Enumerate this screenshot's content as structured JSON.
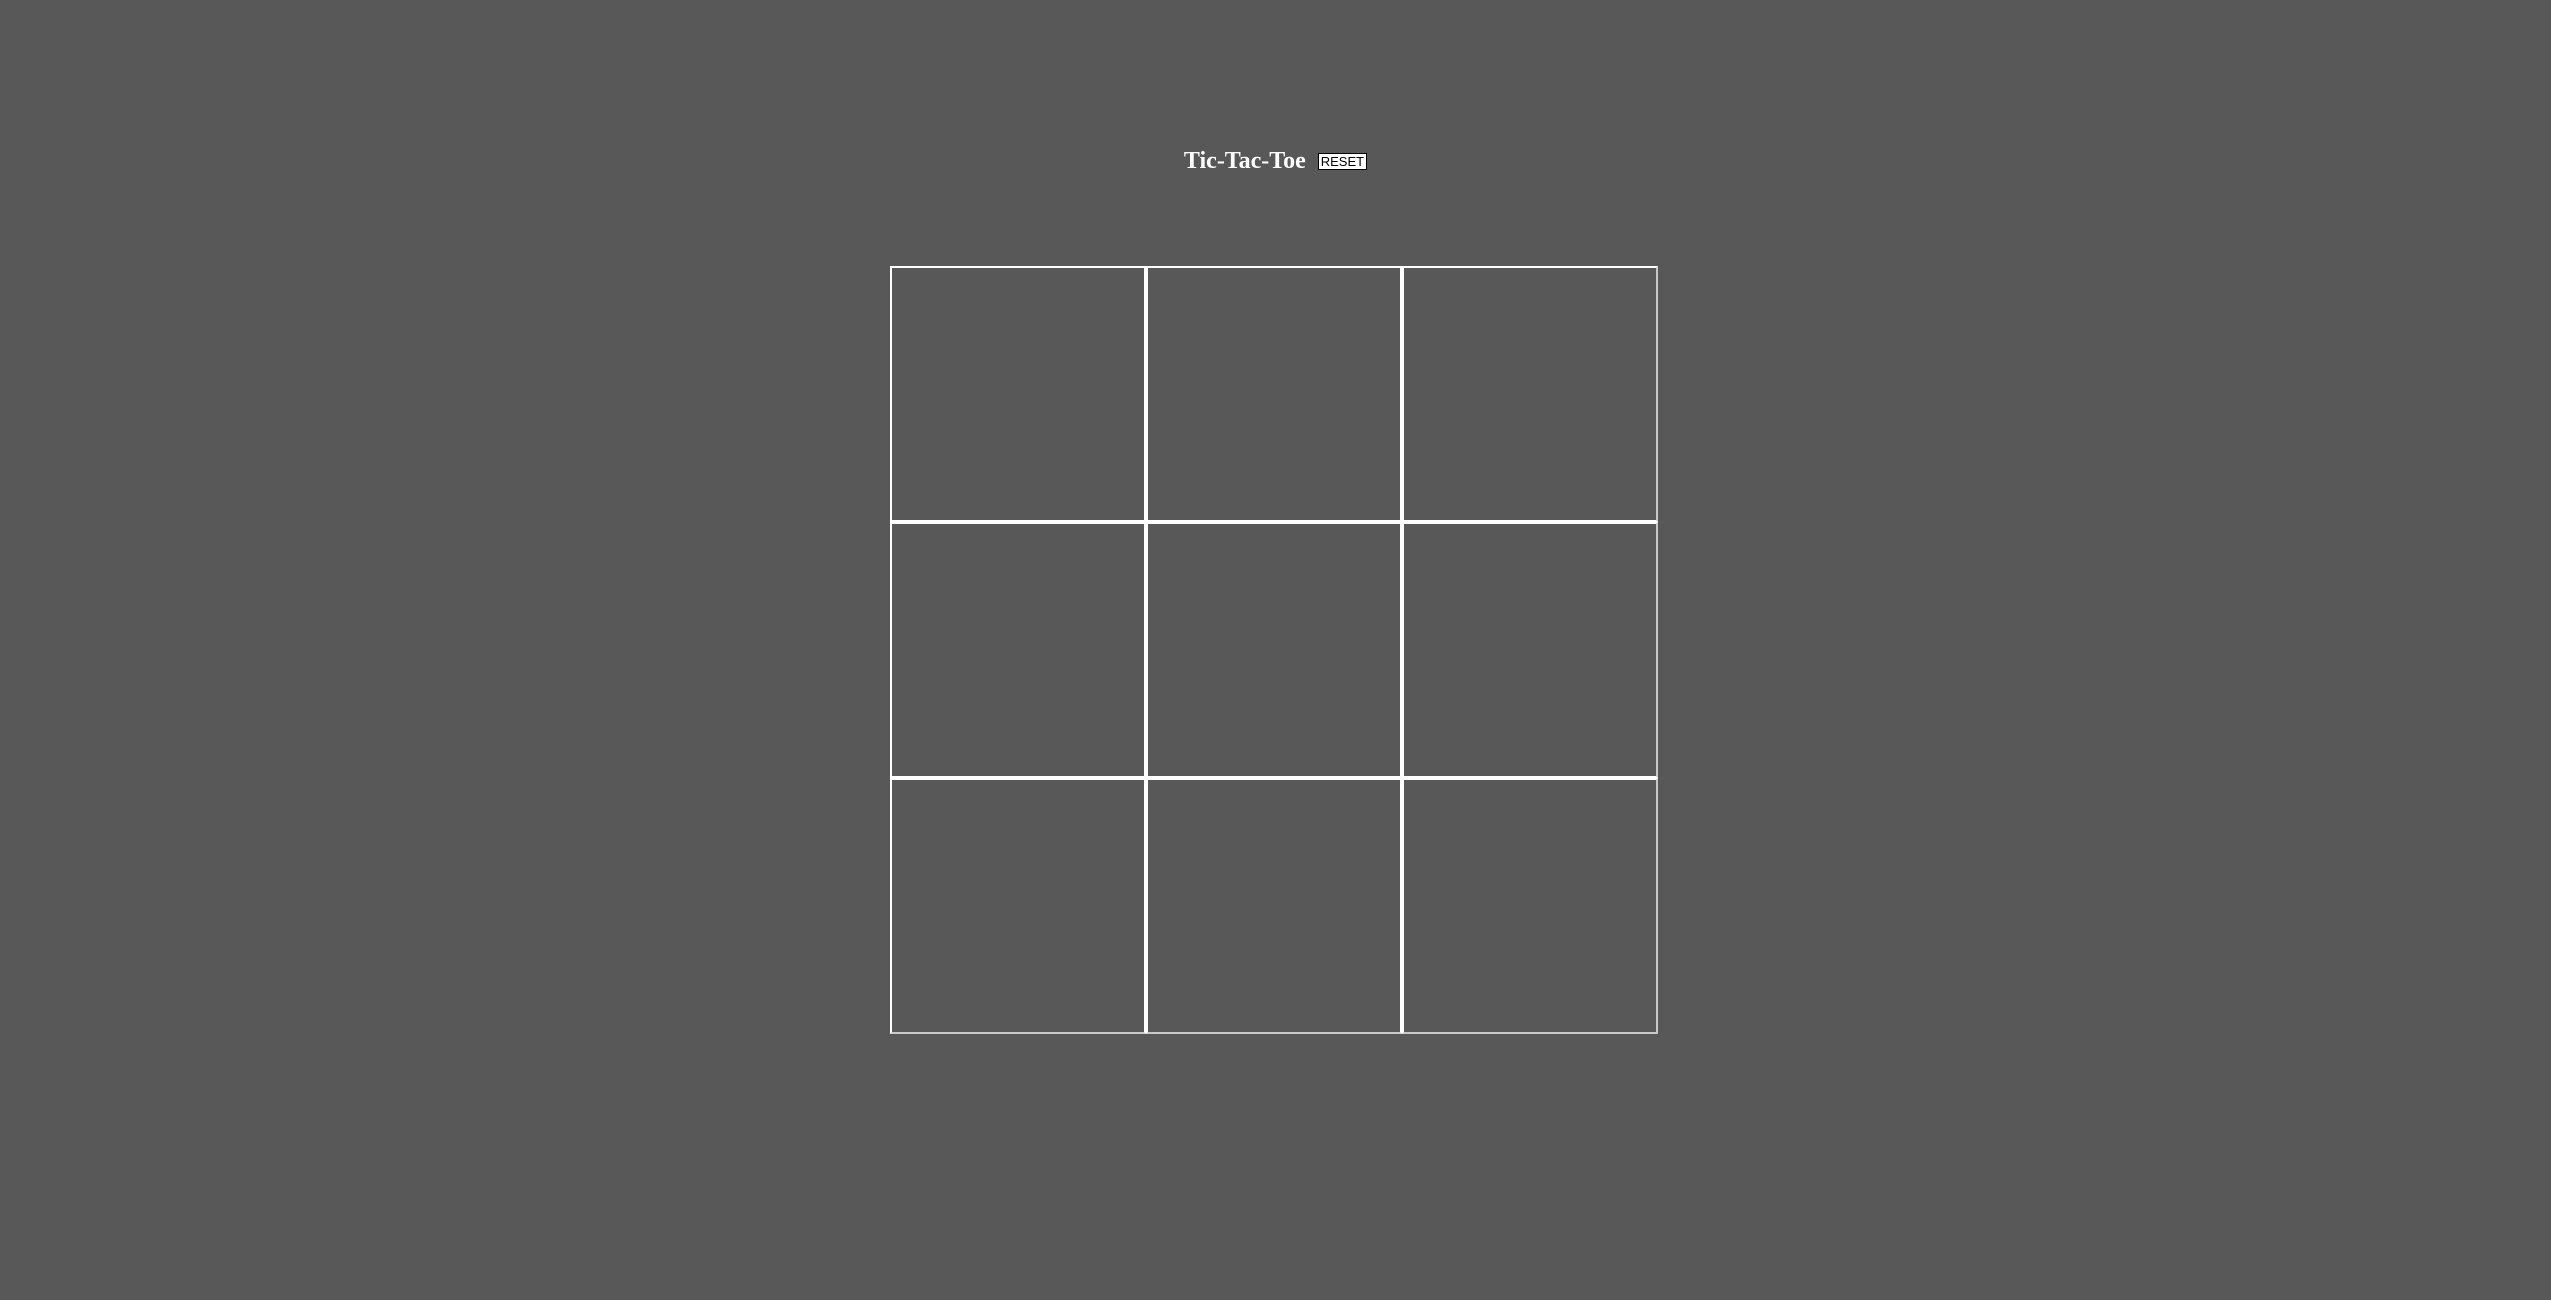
{
  "header": {
    "title": "Tic-Tac-Toe",
    "reset_label": "RESET"
  },
  "board": {
    "cells": [
      "",
      "",
      "",
      "",
      "",
      "",
      "",
      "",
      ""
    ]
  },
  "colors": {
    "background": "#585858",
    "grid_line": "#ffffff",
    "text": "#ffffff"
  }
}
